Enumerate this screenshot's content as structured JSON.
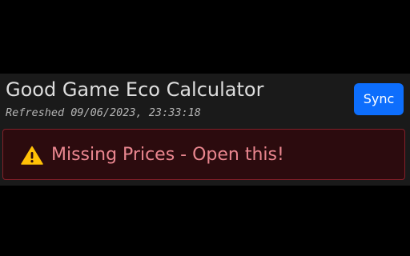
{
  "app": {
    "title": "Good Game Eco Calculator",
    "refreshed": "Refreshed 09/06/2023, 23:33:18"
  },
  "toolbar": {
    "sync_label": "Sync"
  },
  "alert": {
    "icon": "warning-triangle-icon",
    "text": "Missing Prices - Open this!"
  },
  "colors": {
    "background": "#000000",
    "panel": "#1a1a1a",
    "primary_button": "#0d6efd",
    "alert_background": "#2c0b0e",
    "alert_border": "#842029",
    "alert_text": "#ea868f",
    "warning_icon": "#ffc107"
  }
}
